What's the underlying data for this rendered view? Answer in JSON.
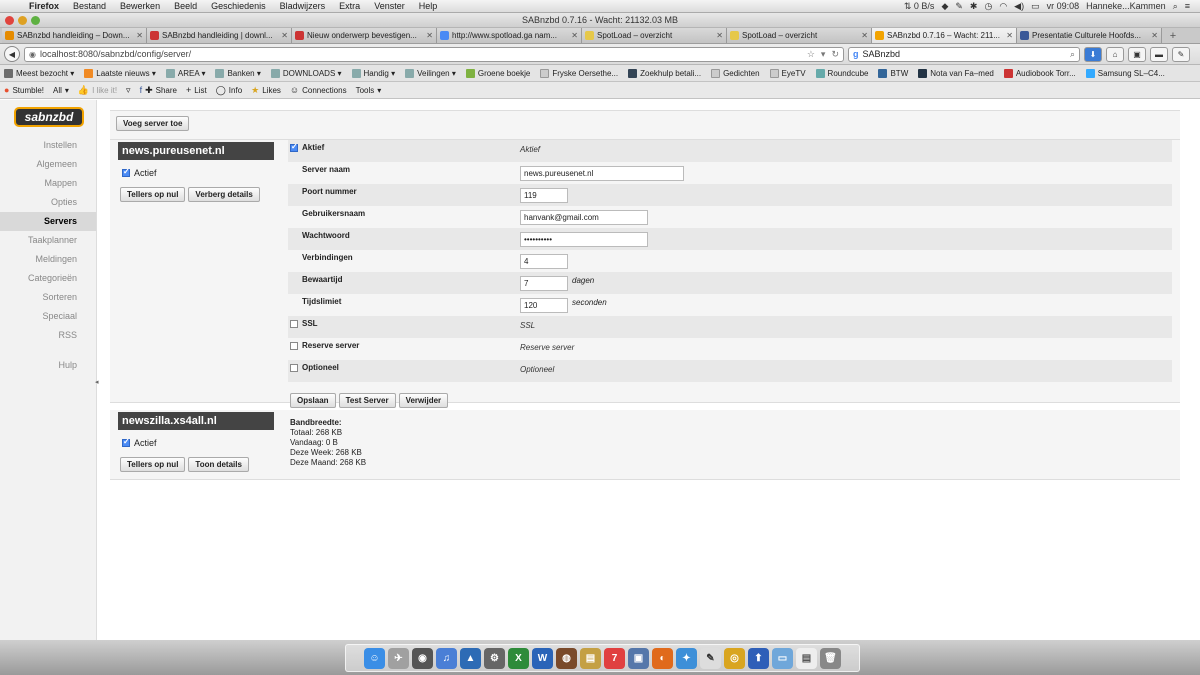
{
  "menubar": {
    "app": "Firefox",
    "items": [
      "Bestand",
      "Bewerken",
      "Beeld",
      "Geschiedenis",
      "Bladwijzers",
      "Extra",
      "Venster",
      "Help"
    ],
    "speed": "0 B/s",
    "clock": "vr 09:08",
    "user": "Hanneke...Kammen"
  },
  "window": {
    "title": "SABnzbd 0.7.16 - Wacht: 21132.03 MB"
  },
  "tabs": [
    {
      "label": "SABnzbd handleiding – Down...",
      "color": "#e58b00"
    },
    {
      "label": "SABnzbd handleiding | downl...",
      "color": "#cc3333"
    },
    {
      "label": "Nieuw onderwerp bevestigen...",
      "color": "#cc3333"
    },
    {
      "label": "http://www.spotload.ga nam...",
      "color": "#4a8af4"
    },
    {
      "label": "SpotLoad – overzicht",
      "color": "#e6c84a"
    },
    {
      "label": "SpotLoad – overzicht",
      "color": "#e6c84a"
    },
    {
      "label": "SABnzbd 0.7.16 – Wacht: 211...",
      "color": "#f2a300"
    },
    {
      "label": "Presentatie Culturele Hoofds...",
      "color": "#3b5998"
    }
  ],
  "nav": {
    "url": "localhost:8080/sabnzbd/config/server/",
    "search_value": "SABnzbd"
  },
  "bookmarks": [
    {
      "label": "Meest bezocht ▾",
      "color": "#6c6c6c"
    },
    {
      "label": "Laatste nieuws ▾",
      "color": "#f08a24"
    },
    {
      "label": "AREA ▾",
      "color": "#8aa"
    },
    {
      "label": "Banken ▾",
      "color": "#8aa"
    },
    {
      "label": "DOWNLOADS ▾",
      "color": "#8aa"
    },
    {
      "label": "Handig ▾",
      "color": "#8aa"
    },
    {
      "label": "Veilingen ▾",
      "color": "#8aa"
    },
    {
      "label": "Groene boekje",
      "color": "#7fb241"
    },
    {
      "label": "Fryske Oersethe...",
      "color": "#ccc"
    },
    {
      "label": "Zoekhulp betali...",
      "color": "#345"
    },
    {
      "label": "Gedichten",
      "color": "#ccc"
    },
    {
      "label": "EyeTV",
      "color": "#ccc"
    },
    {
      "label": "Roundcube",
      "color": "#6aa"
    },
    {
      "label": "BTW",
      "color": "#369"
    },
    {
      "label": "Nota van Fa–med",
      "color": "#234"
    },
    {
      "label": "Audiobook Torr...",
      "color": "#c33"
    },
    {
      "label": "Samsung SL–C4...",
      "color": "#3af"
    }
  ],
  "stumble": {
    "stumble": "Stumble!",
    "all": "All",
    "like": "I like it!",
    "share": "Share",
    "list": "List",
    "info": "Info",
    "likes": "Likes",
    "connections": "Connections",
    "tools": "Tools"
  },
  "sidebar": {
    "logo": "sabnzbd",
    "items": [
      "Instellen",
      "Algemeen",
      "Mappen",
      "Opties",
      "Servers",
      "Taakplanner",
      "Meldingen",
      "Categorieën",
      "Sorteren",
      "Speciaal",
      "RSS"
    ],
    "help": "Hulp"
  },
  "add_server_label": "Voeg server toe",
  "server1": {
    "host": "news.pureusenet.nl",
    "active_label": "Actief",
    "reset_label": "Tellers op nul",
    "hide_label": "Verberg details",
    "form": {
      "enable_label": "Aktief",
      "enable_desc": "Aktief",
      "name_label": "Server naam",
      "name_value": "news.pureusenet.nl",
      "port_label": "Poort nummer",
      "port_value": "119",
      "user_label": "Gebruikersnaam",
      "user_value": "hanvank@gmail.com",
      "pass_label": "Wachtwoord",
      "pass_value": "••••••••••",
      "conn_label": "Verbindingen",
      "conn_value": "4",
      "retention_label": "Bewaartijd",
      "retention_value": "7",
      "retention_unit": "dagen",
      "timeout_label": "Tijdslimiet",
      "timeout_value": "120",
      "timeout_unit": "seconden",
      "ssl_label": "SSL",
      "ssl_desc": "SSL",
      "backup_label": "Reserve server",
      "backup_desc": "Reserve server",
      "optional_label": "Optioneel",
      "optional_desc": "Optioneel",
      "save_label": "Opslaan",
      "test_label": "Test Server",
      "delete_label": "Verwijder"
    }
  },
  "server2": {
    "host": "newszilla.xs4all.nl",
    "active_label": "Actief",
    "reset_label": "Tellers op nul",
    "show_label": "Toon details",
    "bandwidth": {
      "title": "Bandbreedte:",
      "total": "Totaal: 268 KB",
      "today": "Vandaag: 0 B",
      "week": "Deze Week: 268 KB",
      "month": "Deze Maand: 268 KB"
    }
  },
  "dock_icons": [
    {
      "name": "finder",
      "color": "#3a8ee6"
    },
    {
      "name": "launchpad",
      "color": "#a0a0a0"
    },
    {
      "name": "dvd",
      "color": "#555"
    },
    {
      "name": "itunes",
      "color": "#4a7fd6"
    },
    {
      "name": "preview",
      "color": "#2d6bb5"
    },
    {
      "name": "utility",
      "color": "#666"
    },
    {
      "name": "excel",
      "color": "#2e8b3a"
    },
    {
      "name": "word",
      "color": "#2a64b8"
    },
    {
      "name": "photobooth",
      "color": "#7a4a2a"
    },
    {
      "name": "notes",
      "color": "#c4a044"
    },
    {
      "name": "calendar",
      "color": "#e04040"
    },
    {
      "name": "iphoto",
      "color": "#5577aa"
    },
    {
      "name": "firefox",
      "color": "#e06a1c"
    },
    {
      "name": "safari",
      "color": "#3d8fd8"
    },
    {
      "name": "textedit",
      "color": "#ddd"
    },
    {
      "name": "chrome",
      "color": "#d9a520"
    },
    {
      "name": "upload",
      "color": "#2f5fb8"
    },
    {
      "name": "folder",
      "color": "#6fa7da"
    },
    {
      "name": "document",
      "color": "#eeeeee"
    },
    {
      "name": "trash",
      "color": "#888"
    }
  ]
}
